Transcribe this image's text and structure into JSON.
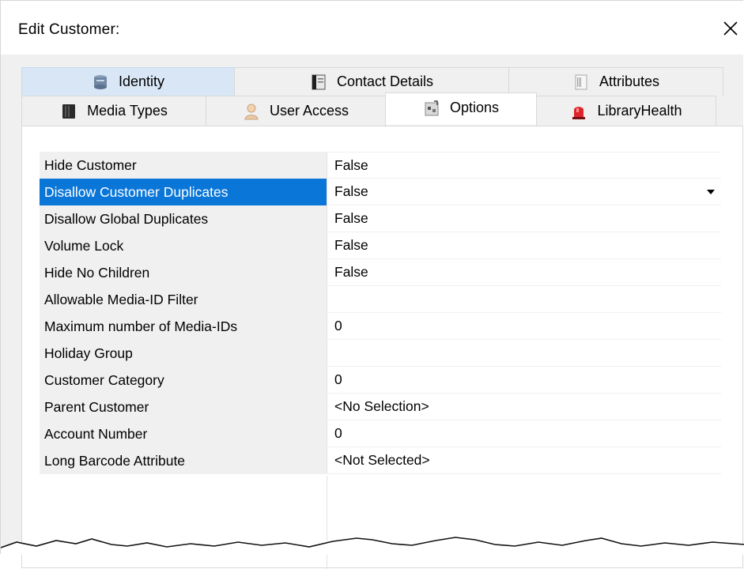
{
  "window": {
    "title": "Edit Customer:",
    "close_glyph": "✕"
  },
  "tabs": {
    "back_row": [
      {
        "label": "Identity",
        "icon": "identity-icon"
      },
      {
        "label": "Contact Details",
        "icon": "contact-details-icon"
      },
      {
        "label": "Attributes",
        "icon": "attributes-icon"
      }
    ],
    "front_row": [
      {
        "label": "Media Types",
        "icon": "media-types-icon"
      },
      {
        "label": "User Access",
        "icon": "user-access-icon"
      },
      {
        "label": "Options",
        "icon": "options-icon"
      },
      {
        "label": "LibraryHealth",
        "icon": "library-health-icon"
      }
    ],
    "active": "Options"
  },
  "properties": [
    {
      "name": "Hide Customer",
      "value": "False"
    },
    {
      "name": "Disallow Customer Duplicates",
      "value": "False",
      "selected": true
    },
    {
      "name": "Disallow Global Duplicates",
      "value": "False"
    },
    {
      "name": "Volume Lock",
      "value": "False"
    },
    {
      "name": "Hide No Children",
      "value": "False"
    },
    {
      "name": "Allowable Media-ID Filter",
      "value": ""
    },
    {
      "name": "Maximum number of Media-IDs",
      "value": "0"
    },
    {
      "name": "Holiday Group",
      "value": ""
    },
    {
      "name": "Customer Category",
      "value": "0"
    },
    {
      "name": "Parent Customer",
      "value": "<No Selection>"
    },
    {
      "name": "Account Number",
      "value": "0"
    },
    {
      "name": "Long Barcode Attribute",
      "value": "<Not Selected>"
    }
  ],
  "colors": {
    "selection": "#0a76d8",
    "tab_highlight": "#d8e6f6",
    "dialog_background": "#f0f0f0"
  }
}
